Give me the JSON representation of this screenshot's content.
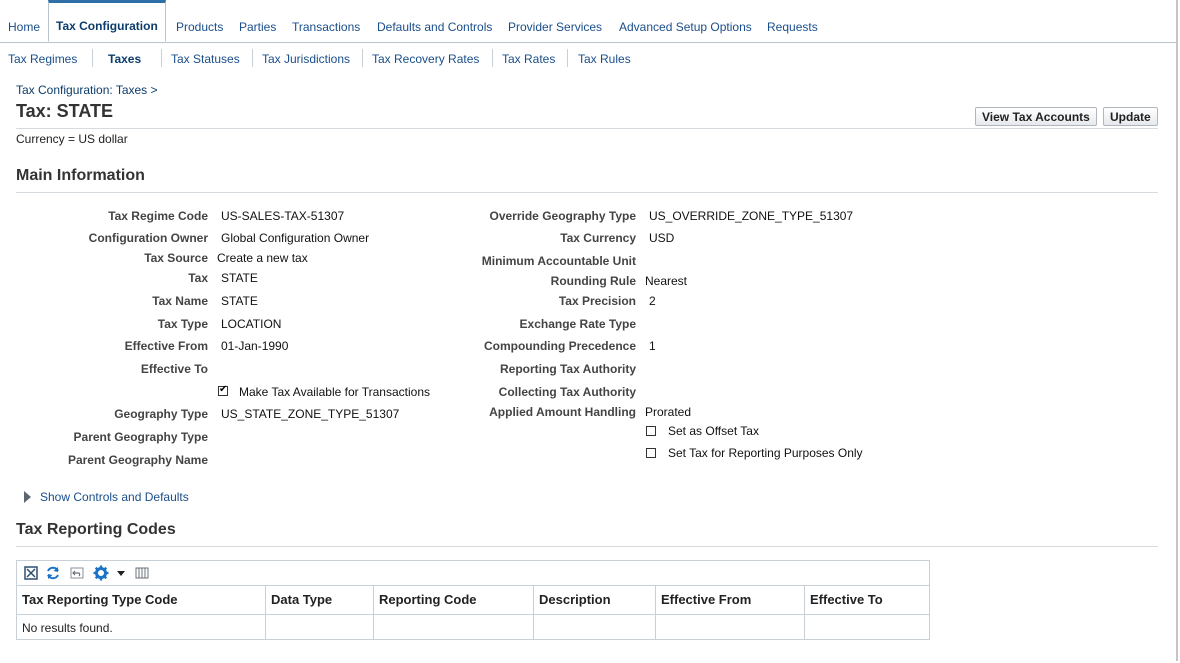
{
  "top_tabs": [
    "Home",
    "Tax Configuration",
    "Products",
    "Parties",
    "Transactions",
    "Defaults and Controls",
    "Provider Services",
    "Advanced Setup Options",
    "Requests"
  ],
  "sub_tabs": [
    "Tax Regimes",
    "Taxes",
    "Tax Statuses",
    "Tax Jurisdictions",
    "Tax Recovery Rates",
    "Tax Rates",
    "Tax Rules"
  ],
  "breadcrumb": "Tax Configuration: Taxes  >",
  "page_title": "Tax: STATE",
  "currency": "Currency = US dollar",
  "buttons": {
    "view_tax_accounts": "View Tax Accounts",
    "update": "Update"
  },
  "main_info": {
    "title": "Main Information",
    "left": [
      {
        "label": "Tax Regime Code",
        "value": "US-SALES-TAX-51307"
      },
      {
        "label": "Configuration Owner",
        "value": "Global Configuration Owner"
      },
      {
        "label": "Tax Source",
        "value": "Create a new tax"
      },
      {
        "label": "Tax",
        "value": "STATE"
      },
      {
        "label": "Tax Name",
        "value": "STATE"
      },
      {
        "label": "Tax Type",
        "value": "LOCATION"
      },
      {
        "label": "Effective From",
        "value": "01-Jan-1990"
      },
      {
        "label": "Effective To",
        "value": ""
      },
      {
        "label": "Geography Type",
        "value": "US_STATE_ZONE_TYPE_51307"
      },
      {
        "label": "Parent Geography Type",
        "value": ""
      },
      {
        "label": "Parent Geography Name",
        "value": ""
      }
    ],
    "make_available_label": "Make Tax Available for Transactions",
    "right": [
      {
        "label": "Override Geography Type",
        "value": "US_OVERRIDE_ZONE_TYPE_51307"
      },
      {
        "label": "Tax Currency",
        "value": "USD"
      },
      {
        "label": "Minimum Accountable Unit",
        "value": ""
      },
      {
        "label": "Rounding Rule",
        "value": "Nearest"
      },
      {
        "label": "Tax Precision",
        "value": "2"
      },
      {
        "label": "Exchange Rate Type",
        "value": ""
      },
      {
        "label": "Compounding Precedence",
        "value": "1"
      },
      {
        "label": "Reporting Tax Authority",
        "value": ""
      },
      {
        "label": "Collecting Tax Authority",
        "value": ""
      },
      {
        "label": "Applied Amount Handling",
        "value": "Prorated"
      }
    ],
    "offset_label": "Set as Offset Tax",
    "reporting_only_label": "Set Tax for Reporting Purposes Only"
  },
  "show_controls": "Show Controls and Defaults",
  "reporting_codes": {
    "title": "Tax Reporting Codes",
    "columns": [
      "Tax Reporting Type Code",
      "Data Type",
      "Reporting Code",
      "Description",
      "Effective From",
      "Effective To"
    ],
    "empty_text": "No results found."
  },
  "icons": [
    "detach-icon",
    "refresh-icon",
    "undo-icon",
    "gear-icon",
    "chevron-down-icon",
    "freeze-columns-icon"
  ],
  "colors": {
    "link": "#1a4e8a",
    "accent": "#2f6fa8",
    "border": "#c8d0d6"
  }
}
